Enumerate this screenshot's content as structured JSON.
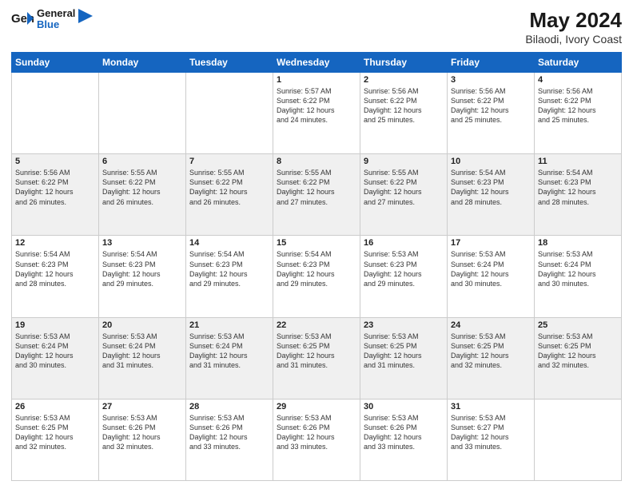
{
  "header": {
    "logo_general": "General",
    "logo_blue": "Blue",
    "month_year": "May 2024",
    "location": "Bilaodi, Ivory Coast"
  },
  "weekdays": [
    "Sunday",
    "Monday",
    "Tuesday",
    "Wednesday",
    "Thursday",
    "Friday",
    "Saturday"
  ],
  "weeks": [
    [
      {
        "day": "",
        "content": ""
      },
      {
        "day": "",
        "content": ""
      },
      {
        "day": "",
        "content": ""
      },
      {
        "day": "1",
        "content": "Sunrise: 5:57 AM\nSunset: 6:22 PM\nDaylight: 12 hours\nand 24 minutes."
      },
      {
        "day": "2",
        "content": "Sunrise: 5:56 AM\nSunset: 6:22 PM\nDaylight: 12 hours\nand 25 minutes."
      },
      {
        "day": "3",
        "content": "Sunrise: 5:56 AM\nSunset: 6:22 PM\nDaylight: 12 hours\nand 25 minutes."
      },
      {
        "day": "4",
        "content": "Sunrise: 5:56 AM\nSunset: 6:22 PM\nDaylight: 12 hours\nand 25 minutes."
      }
    ],
    [
      {
        "day": "5",
        "content": "Sunrise: 5:56 AM\nSunset: 6:22 PM\nDaylight: 12 hours\nand 26 minutes."
      },
      {
        "day": "6",
        "content": "Sunrise: 5:55 AM\nSunset: 6:22 PM\nDaylight: 12 hours\nand 26 minutes."
      },
      {
        "day": "7",
        "content": "Sunrise: 5:55 AM\nSunset: 6:22 PM\nDaylight: 12 hours\nand 26 minutes."
      },
      {
        "day": "8",
        "content": "Sunrise: 5:55 AM\nSunset: 6:22 PM\nDaylight: 12 hours\nand 27 minutes."
      },
      {
        "day": "9",
        "content": "Sunrise: 5:55 AM\nSunset: 6:22 PM\nDaylight: 12 hours\nand 27 minutes."
      },
      {
        "day": "10",
        "content": "Sunrise: 5:54 AM\nSunset: 6:23 PM\nDaylight: 12 hours\nand 28 minutes."
      },
      {
        "day": "11",
        "content": "Sunrise: 5:54 AM\nSunset: 6:23 PM\nDaylight: 12 hours\nand 28 minutes."
      }
    ],
    [
      {
        "day": "12",
        "content": "Sunrise: 5:54 AM\nSunset: 6:23 PM\nDaylight: 12 hours\nand 28 minutes."
      },
      {
        "day": "13",
        "content": "Sunrise: 5:54 AM\nSunset: 6:23 PM\nDaylight: 12 hours\nand 29 minutes."
      },
      {
        "day": "14",
        "content": "Sunrise: 5:54 AM\nSunset: 6:23 PM\nDaylight: 12 hours\nand 29 minutes."
      },
      {
        "day": "15",
        "content": "Sunrise: 5:54 AM\nSunset: 6:23 PM\nDaylight: 12 hours\nand 29 minutes."
      },
      {
        "day": "16",
        "content": "Sunrise: 5:53 AM\nSunset: 6:23 PM\nDaylight: 12 hours\nand 29 minutes."
      },
      {
        "day": "17",
        "content": "Sunrise: 5:53 AM\nSunset: 6:24 PM\nDaylight: 12 hours\nand 30 minutes."
      },
      {
        "day": "18",
        "content": "Sunrise: 5:53 AM\nSunset: 6:24 PM\nDaylight: 12 hours\nand 30 minutes."
      }
    ],
    [
      {
        "day": "19",
        "content": "Sunrise: 5:53 AM\nSunset: 6:24 PM\nDaylight: 12 hours\nand 30 minutes."
      },
      {
        "day": "20",
        "content": "Sunrise: 5:53 AM\nSunset: 6:24 PM\nDaylight: 12 hours\nand 31 minutes."
      },
      {
        "day": "21",
        "content": "Sunrise: 5:53 AM\nSunset: 6:24 PM\nDaylight: 12 hours\nand 31 minutes."
      },
      {
        "day": "22",
        "content": "Sunrise: 5:53 AM\nSunset: 6:25 PM\nDaylight: 12 hours\nand 31 minutes."
      },
      {
        "day": "23",
        "content": "Sunrise: 5:53 AM\nSunset: 6:25 PM\nDaylight: 12 hours\nand 31 minutes."
      },
      {
        "day": "24",
        "content": "Sunrise: 5:53 AM\nSunset: 6:25 PM\nDaylight: 12 hours\nand 32 minutes."
      },
      {
        "day": "25",
        "content": "Sunrise: 5:53 AM\nSunset: 6:25 PM\nDaylight: 12 hours\nand 32 minutes."
      }
    ],
    [
      {
        "day": "26",
        "content": "Sunrise: 5:53 AM\nSunset: 6:25 PM\nDaylight: 12 hours\nand 32 minutes."
      },
      {
        "day": "27",
        "content": "Sunrise: 5:53 AM\nSunset: 6:26 PM\nDaylight: 12 hours\nand 32 minutes."
      },
      {
        "day": "28",
        "content": "Sunrise: 5:53 AM\nSunset: 6:26 PM\nDaylight: 12 hours\nand 33 minutes."
      },
      {
        "day": "29",
        "content": "Sunrise: 5:53 AM\nSunset: 6:26 PM\nDaylight: 12 hours\nand 33 minutes."
      },
      {
        "day": "30",
        "content": "Sunrise: 5:53 AM\nSunset: 6:26 PM\nDaylight: 12 hours\nand 33 minutes."
      },
      {
        "day": "31",
        "content": "Sunrise: 5:53 AM\nSunset: 6:27 PM\nDaylight: 12 hours\nand 33 minutes."
      },
      {
        "day": "",
        "content": ""
      }
    ]
  ]
}
